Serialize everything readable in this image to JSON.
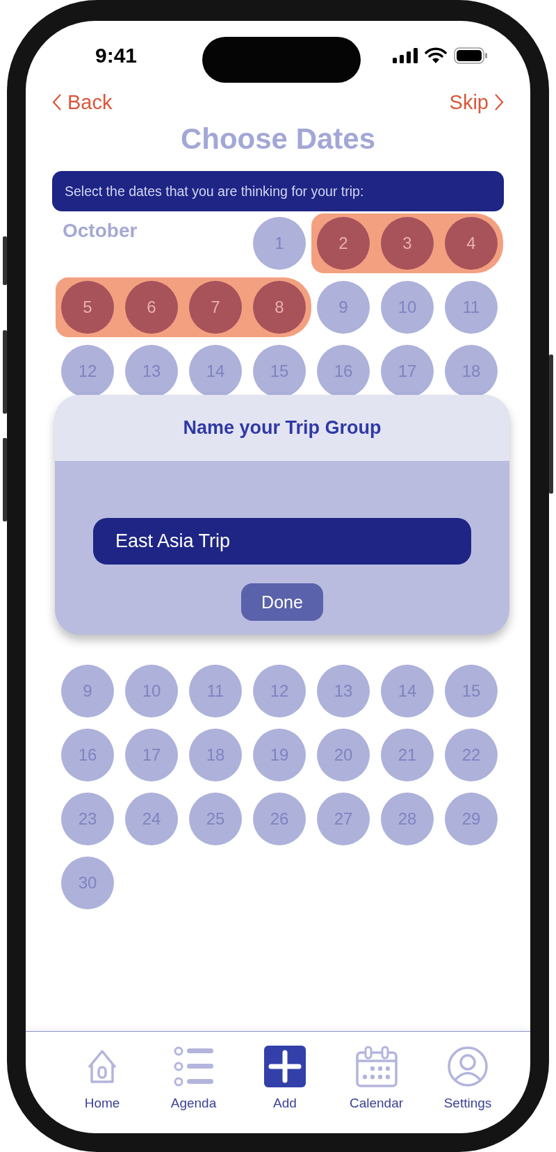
{
  "status_bar": {
    "time": "9:41"
  },
  "nav": {
    "back": "Back",
    "skip": "Skip"
  },
  "title": "Choose Dates",
  "instruction": "Select the dates that you are thinking for your trip:",
  "months": [
    {
      "name": "October",
      "days": [
        {
          "label": "1",
          "selected": false
        },
        {
          "label": "2",
          "selected": true
        },
        {
          "label": "3",
          "selected": true
        },
        {
          "label": "4",
          "selected": true
        },
        {
          "label": "5",
          "selected": true
        },
        {
          "label": "6",
          "selected": true
        },
        {
          "label": "7",
          "selected": true
        },
        {
          "label": "8",
          "selected": true
        },
        {
          "label": "9",
          "selected": false
        },
        {
          "label": "10",
          "selected": false
        },
        {
          "label": "11",
          "selected": false
        },
        {
          "label": "12",
          "selected": false
        },
        {
          "label": "13",
          "selected": false
        },
        {
          "label": "14",
          "selected": false
        },
        {
          "label": "15",
          "selected": false
        },
        {
          "label": "16",
          "selected": false
        },
        {
          "label": "17",
          "selected": false
        },
        {
          "label": "18",
          "selected": false
        }
      ]
    },
    {
      "days": [
        {
          "label": "9",
          "selected": false
        },
        {
          "label": "10",
          "selected": false
        },
        {
          "label": "11",
          "selected": false
        },
        {
          "label": "12",
          "selected": false
        },
        {
          "label": "13",
          "selected": false
        },
        {
          "label": "14",
          "selected": false
        },
        {
          "label": "15",
          "selected": false
        },
        {
          "label": "16",
          "selected": false
        },
        {
          "label": "17",
          "selected": false
        },
        {
          "label": "18",
          "selected": false
        },
        {
          "label": "19",
          "selected": false
        },
        {
          "label": "20",
          "selected": false
        },
        {
          "label": "21",
          "selected": false
        },
        {
          "label": "22",
          "selected": false
        },
        {
          "label": "23",
          "selected": false
        },
        {
          "label": "24",
          "selected": false
        },
        {
          "label": "25",
          "selected": false
        },
        {
          "label": "26",
          "selected": false
        },
        {
          "label": "27",
          "selected": false
        },
        {
          "label": "28",
          "selected": false
        },
        {
          "label": "29",
          "selected": false
        },
        {
          "label": "30",
          "selected": false
        }
      ]
    }
  ],
  "dialog": {
    "title": "Name your Trip Group",
    "input": {
      "value": "East Asia Trip"
    },
    "button": "Done"
  },
  "tab_bar": [
    {
      "label": "Home"
    },
    {
      "label": "Agenda"
    },
    {
      "label": "Add"
    },
    {
      "label": "Calendar"
    },
    {
      "label": "Settings"
    }
  ]
}
